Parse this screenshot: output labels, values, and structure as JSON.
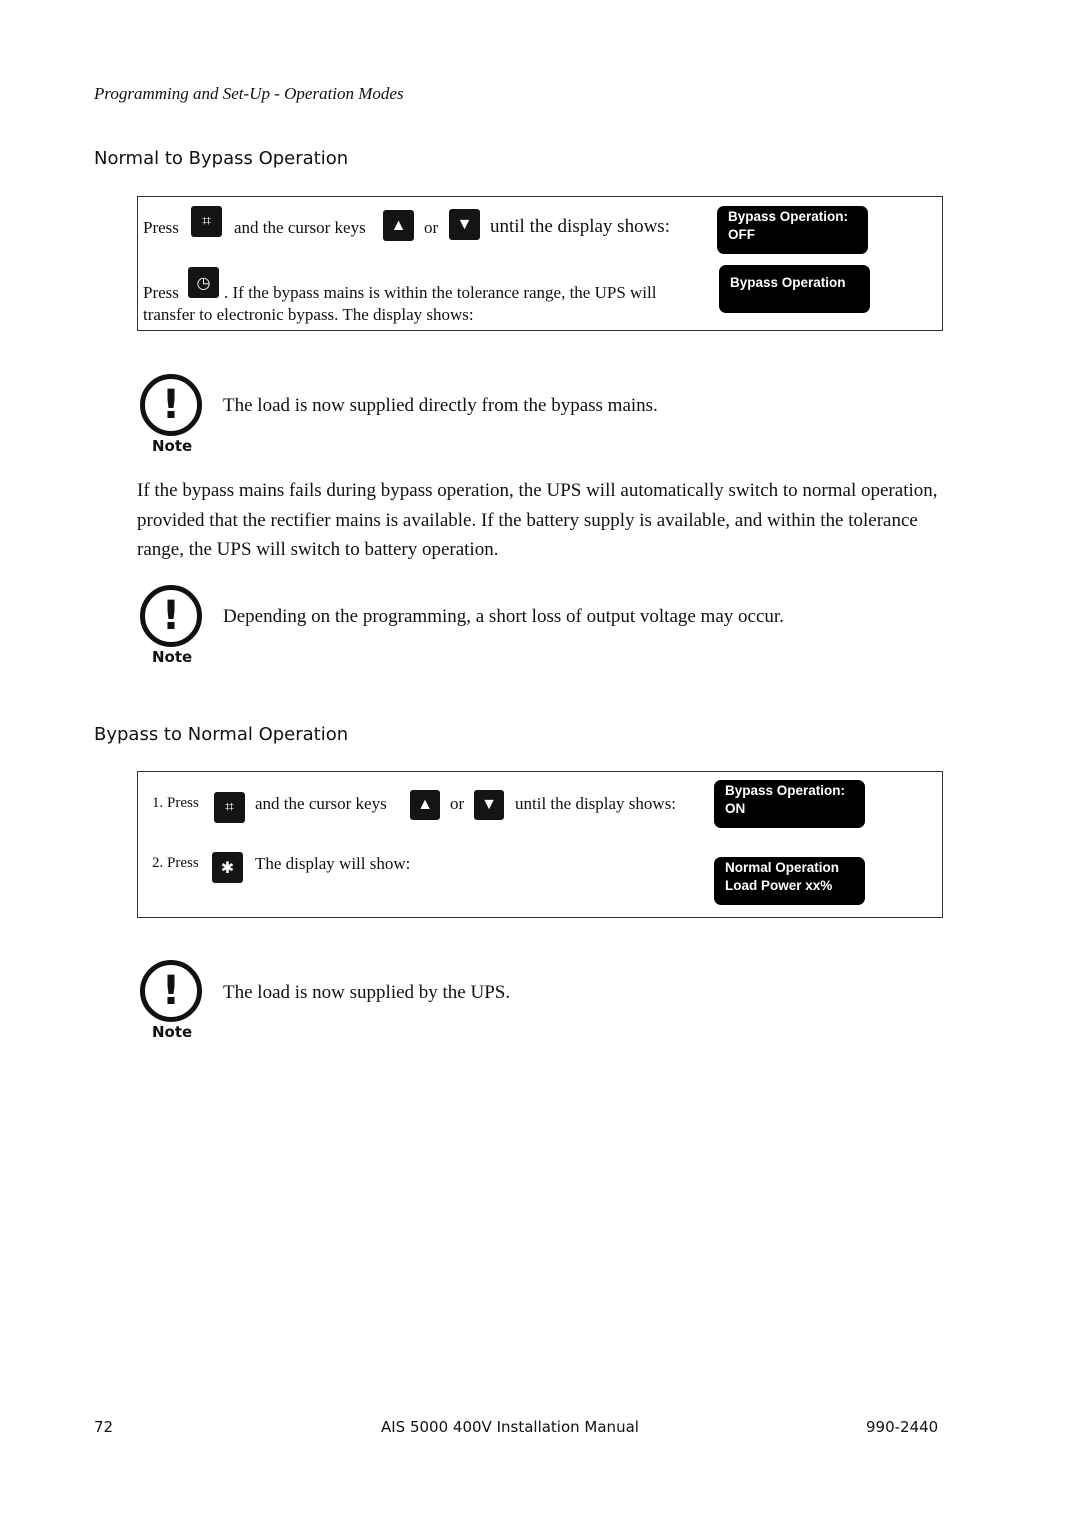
{
  "running_header": "Programming and Set-Up - Operation Modes",
  "section1": {
    "title": "Normal to Bypass Operation",
    "press": "Press",
    "and_cursor": "and the cursor keys",
    "or": "or",
    "until": "until the display shows:",
    "press2": "Press",
    "line2": ". If the bypass mains is within the tolerance range, the UPS will",
    "line3": "transfer to electronic bypass. The display shows:",
    "display1": [
      "Bypass Operation:",
      "OFF"
    ],
    "display2": [
      "Bypass Operation"
    ]
  },
  "note1": {
    "label": "Note",
    "text": "The load is now supplied directly from the bypass mains."
  },
  "paragraph": "If the bypass mains fails during bypass operation, the UPS will automatically switch to normal operation, provided that the rectifier mains is available. If the battery supply is available, and within the tolerance range, the UPS will switch to battery operation.",
  "note2": {
    "label": "Note",
    "text": "Depending on the programming, a short loss of output voltage may occur."
  },
  "section2": {
    "title": "Bypass to Normal Operation",
    "step1": "1. Press",
    "and_cursor": "and the cursor keys",
    "or": "or",
    "until": "until the display shows:",
    "step2": "2. Press",
    "display_will": "The display will show:",
    "display1": [
      "Bypass Operation:",
      "ON"
    ],
    "display2": [
      "Normal Operation",
      "Load Power xx%"
    ]
  },
  "note3": {
    "label": "Note",
    "text": "The load is now supplied by the UPS."
  },
  "footer": {
    "page": "72",
    "title": "AIS 5000 400V Installation Manual",
    "doc": "990-2440"
  }
}
